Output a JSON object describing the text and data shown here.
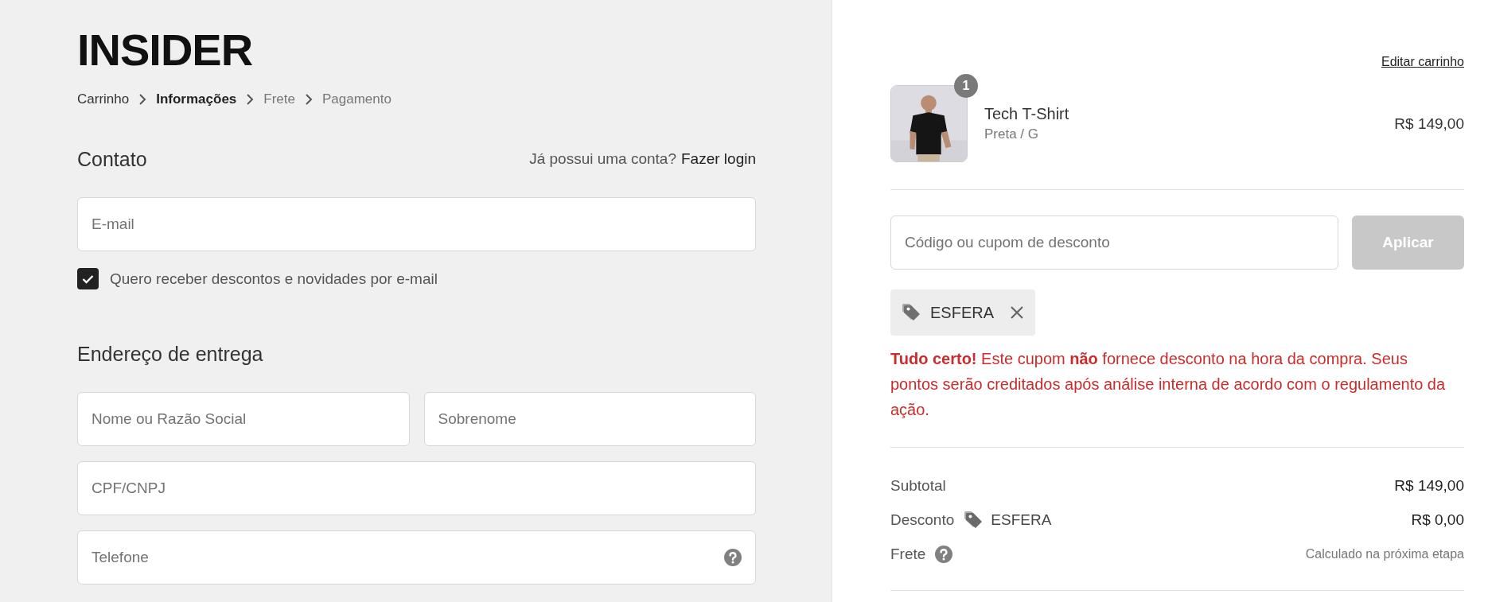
{
  "logo": {
    "text": "INSIDER"
  },
  "breadcrumb": [
    {
      "label": "Carrinho",
      "selected": false,
      "visited": true
    },
    {
      "label": "Informações",
      "selected": true
    },
    {
      "label": "Frete",
      "selected": false,
      "visited": false
    },
    {
      "label": "Pagamento",
      "selected": false,
      "visited": false
    }
  ],
  "contact": {
    "title": "Contato",
    "login_prompt": "Já possui uma conta?",
    "login_link": "Fazer login",
    "email": {
      "placeholder": "E-mail"
    },
    "newsletter": {
      "label": "Quero receber descontos e novidades por e-mail",
      "checked": true
    }
  },
  "shipping_address": {
    "title": "Endereço de entrega",
    "rows": [
      [
        {
          "placeholder": "Nome ou Razão Social"
        },
        {
          "placeholder": "Sobrenome"
        }
      ],
      [
        {
          "placeholder": "CPF/CNPJ"
        }
      ],
      [
        {
          "placeholder": "Telefone",
          "help": true
        }
      ]
    ]
  },
  "cart": {
    "edit_link": "Editar carrinho",
    "items": [
      {
        "name": "Tech T-Shirt",
        "variant": "Preta / G",
        "price": "R$ 149,00",
        "quantity": "1"
      }
    ],
    "discount_field": {
      "placeholder": "Código ou cupom de desconto"
    },
    "apply_button": {
      "label": "Aplicar",
      "disabled": true
    },
    "applied_coupons": [
      {
        "code": "ESFERA",
        "removable": true
      }
    ],
    "coupon_message": "**Tudo certo!** Este cupom **não** fornece desconto na hora da compra. Seus pontos serão creditados após análise interna de acordo com o regulamento da ação.",
    "summary": [
      {
        "kind": "amount",
        "label": "Subtotal",
        "value": "R$ 149,00"
      },
      {
        "kind": "discount",
        "label": "Desconto",
        "coupon": "ESFERA",
        "value": "R$ 0,00"
      },
      {
        "kind": "note",
        "label": "Frete",
        "help": true,
        "value": "Calculado na próxima etapa"
      }
    ]
  }
}
